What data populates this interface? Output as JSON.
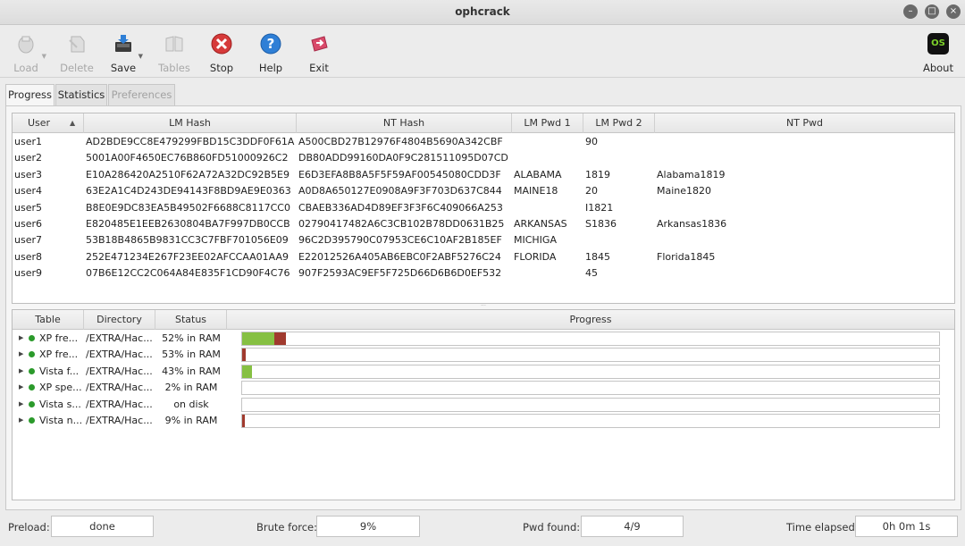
{
  "window": {
    "title": "ophcrack"
  },
  "toolbar": {
    "load": "Load",
    "delete": "Delete",
    "save": "Save",
    "tables": "Tables",
    "stop": "Stop",
    "help": "Help",
    "exit": "Exit",
    "about": "About",
    "about_badge": "OS"
  },
  "tabs": {
    "progress": "Progress",
    "statistics": "Statistics",
    "preferences": "Preferences"
  },
  "hashes": {
    "sort_arrow": "▲",
    "columns": {
      "user": "User",
      "lm_hash": "LM Hash",
      "nt_hash": "NT Hash",
      "lm_pwd1": "LM Pwd 1",
      "lm_pwd2": "LM Pwd 2",
      "nt_pwd": "NT Pwd"
    },
    "rows": [
      {
        "user": "user1",
        "lm_hash": "AD2BDE9CC8E479299FBD15C3DDF0F61A",
        "nt_hash": "A500CBD27B12976F4804B5690A342CBF",
        "lm_pwd1": "",
        "lm_pwd2": "90",
        "nt_pwd": ""
      },
      {
        "user": "user2",
        "lm_hash": "5001A00F4650EC76B860FD51000926C2",
        "nt_hash": "DB80ADD99160DA0F9C281511095D07CD",
        "lm_pwd1": "",
        "lm_pwd2": "",
        "nt_pwd": ""
      },
      {
        "user": "user3",
        "lm_hash": "E10A286420A2510F62A72A32DC92B5E9",
        "nt_hash": "E6D3EFA8B8A5F5F59AF00545080CDD3F",
        "lm_pwd1": "ALABAMA",
        "lm_pwd2": "1819",
        "nt_pwd": "Alabama1819"
      },
      {
        "user": "user4",
        "lm_hash": "63E2A1C4D243DE94143F8BD9AE9E0363",
        "nt_hash": "A0D8A650127E0908A9F3F703D637C844",
        "lm_pwd1": "MAINE18",
        "lm_pwd2": "20",
        "nt_pwd": "Maine1820"
      },
      {
        "user": "user5",
        "lm_hash": "B8E0E9DC83EA5B49502F6688C8117CC0",
        "nt_hash": "CBAEB336AD4D89EF3F3F6C409066A253",
        "lm_pwd1": "",
        "lm_pwd2": "I1821",
        "nt_pwd": ""
      },
      {
        "user": "user6",
        "lm_hash": "E820485E1EEB2630804BA7F997DB0CCB",
        "nt_hash": "02790417482A6C3CB102B78DD0631B25",
        "lm_pwd1": "ARKANSAS",
        "lm_pwd2": "S1836",
        "nt_pwd": "Arkansas1836"
      },
      {
        "user": "user7",
        "lm_hash": "53B18B4865B9831CC3C7FBF701056E09",
        "nt_hash": "96C2D395790C07953CE6C10AF2B185EF",
        "lm_pwd1": "MICHIGA",
        "lm_pwd2": "",
        "nt_pwd": ""
      },
      {
        "user": "user8",
        "lm_hash": "252E471234E267F23EE02AFCCAA01AA9",
        "nt_hash": "E22012526A405AB6EBC0F2ABF5276C24",
        "lm_pwd1": "FLORIDA",
        "lm_pwd2": "1845",
        "nt_pwd": "Florida1845"
      },
      {
        "user": "user9",
        "lm_hash": "07B6E12CC2C064A84E835F1CD90F4C76",
        "nt_hash": "907F2593AC9EF5F725D66D6B6D0EF532",
        "lm_pwd1": "",
        "lm_pwd2": "45",
        "nt_pwd": ""
      }
    ]
  },
  "tables": {
    "columns": {
      "table": "Table",
      "directory": "Directory",
      "status": "Status",
      "progress": "Progress"
    },
    "rows": [
      {
        "table": "XP fre...",
        "directory": "/EXTRA/Hac...",
        "status": "52% in RAM",
        "green": 0.046,
        "red": 0.017
      },
      {
        "table": "XP fre...",
        "directory": "/EXTRA/Hac...",
        "status": "53% in RAM",
        "green": 0.0,
        "red": 0.005
      },
      {
        "table": "Vista f...",
        "directory": "/EXTRA/Hac...",
        "status": "43% in RAM",
        "green": 0.014,
        "red": 0.0
      },
      {
        "table": "XP spe...",
        "directory": "/EXTRA/Hac...",
        "status": "2% in RAM",
        "green": 0.0,
        "red": 0.0
      },
      {
        "table": "Vista s...",
        "directory": "/EXTRA/Hac...",
        "status": "on disk",
        "green": 0.0,
        "red": 0.0
      },
      {
        "table": "Vista n...",
        "directory": "/EXTRA/Hac...",
        "status": "9% in RAM",
        "green": 0.0,
        "red": 0.004
      }
    ]
  },
  "statusbar": {
    "preload_label": "Preload:",
    "preload_value": "done",
    "brute_label": "Brute force:",
    "brute_value": "9%",
    "pwd_label": "Pwd found:",
    "pwd_value": "4/9",
    "time_label": "Time elapsed:",
    "time_value": "0h 0m 1s"
  },
  "colors": {
    "progress_green": "#86c043",
    "progress_red": "#a03a2e",
    "stop_red": "#d63a3a",
    "help_blue": "#2f7fd6"
  }
}
